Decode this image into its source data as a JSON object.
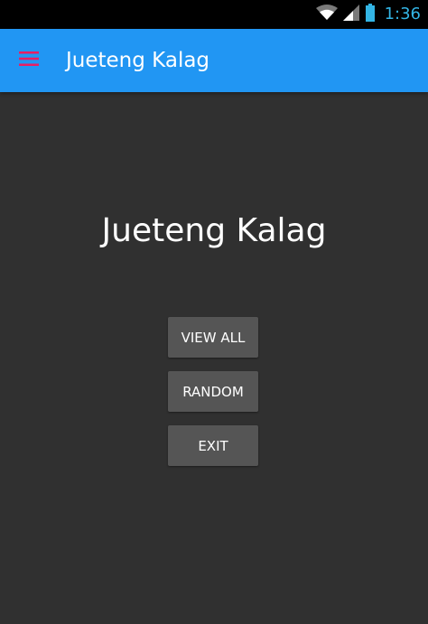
{
  "status_bar": {
    "time": "1:36",
    "icons": [
      "wifi-icon",
      "signal-icon",
      "battery-icon"
    ],
    "time_color": "#33b5e5"
  },
  "app_bar": {
    "title": "Jueteng Kalag",
    "menu_icon": "hamburger-menu-icon",
    "background": "#2196f3",
    "menu_icon_color": "#e91e63"
  },
  "main": {
    "title": "Jueteng Kalag",
    "buttons": [
      {
        "label": "VIEW ALL"
      },
      {
        "label": "RANDOM"
      },
      {
        "label": "EXIT"
      }
    ]
  },
  "colors": {
    "background": "#303030",
    "button": "#555555"
  }
}
